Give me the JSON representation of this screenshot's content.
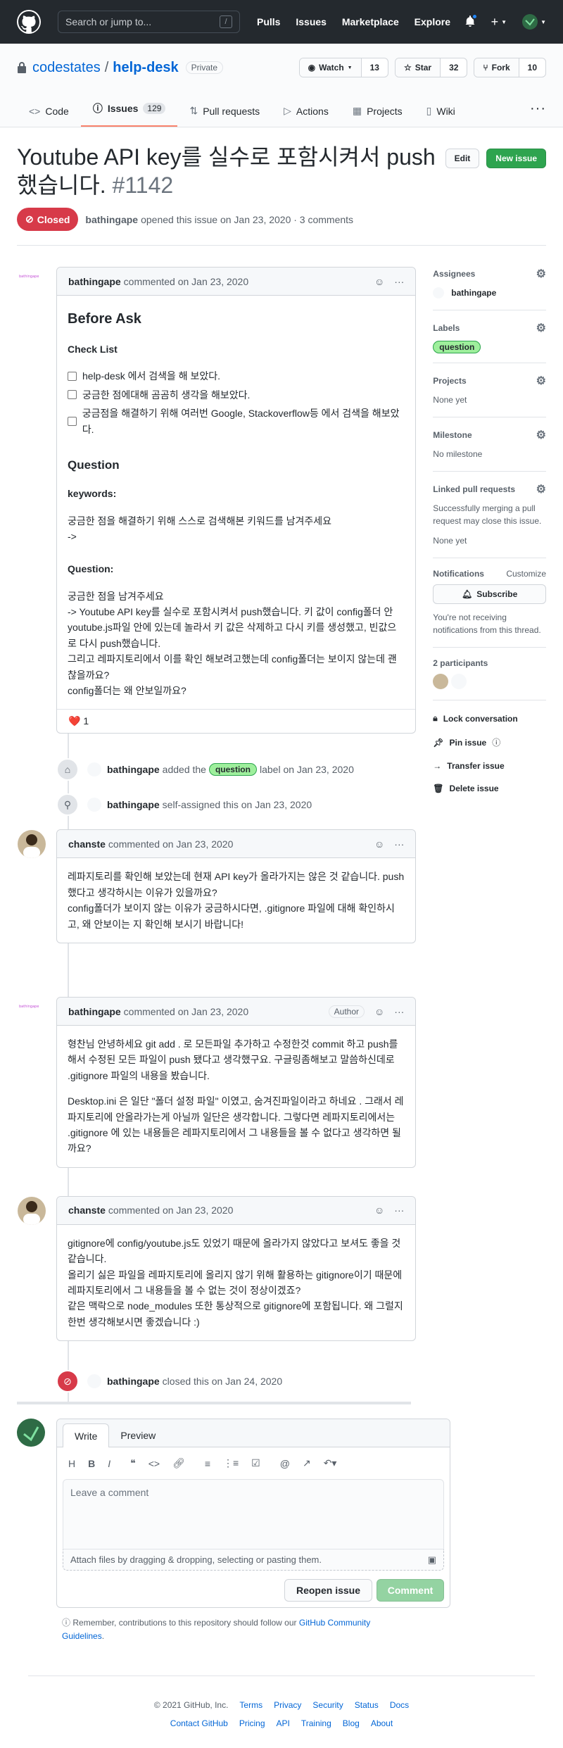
{
  "header": {
    "search_placeholder": "Search or jump to...",
    "slash": "/",
    "nav": [
      "Pulls",
      "Issues",
      "Marketplace",
      "Explore"
    ],
    "plus": "+"
  },
  "repo": {
    "owner": "codestates",
    "sep": "/",
    "name": "help-desk",
    "visibility": "Private",
    "watch_label": "Watch",
    "watch_count": "13",
    "star_label": "Star",
    "star_count": "32",
    "fork_label": "Fork",
    "fork_count": "10",
    "tabs": [
      {
        "label": "Code"
      },
      {
        "label": "Issues",
        "count": "129"
      },
      {
        "label": "Pull requests"
      },
      {
        "label": "Actions"
      },
      {
        "label": "Projects"
      },
      {
        "label": "Wiki"
      }
    ]
  },
  "issue": {
    "title": "Youtube API key를 실수로 포함시켜서 push했습니다.",
    "number": "#1142",
    "edit_label": "Edit",
    "new_issue_label": "New issue",
    "state": "Closed",
    "author": "bathingape",
    "opened_text": "opened this issue on Jan 23, 2020 · 3 comments"
  },
  "comments": [
    {
      "author": "bathingape",
      "date": "commented on Jan 23, 2020",
      "h_before": "Before Ask",
      "h_checklist": "Check List",
      "checklist": [
        "help-desk 에서 검색을 해 보았다.",
        "궁금한 점에대해 곰곰히 생각을 해보았다.",
        "궁금점을 해결하기 위해 여러번 Google, Stackoverflow등 에서 검색을 해보았다."
      ],
      "h_question": "Question",
      "h_keywords": "keywords:",
      "keywords_text": "궁금한 점을 해결하기 위해 스스로 검색해본 키워드를 남겨주세요",
      "keywords_arrow": "->",
      "h_question2": "Question:",
      "question_lines": [
        "궁금한 점을 남겨주세요",
        "-> Youtube API key를 실수로 포함시켜서 push했습니다. 키 값이 config폴더 안 youtube.js파일 안에 있는데 놀라서 키 값은 삭제하고 다시 키를 생성했고, 빈값으로 다시 push했습니다.",
        "그리고 레파지토리에서 이를 확인 해보려고했는데 config폴더는 보이지 않는데 괜찮을까요?",
        "config폴더는 왜 안보일까요?"
      ],
      "reaction_emoji": "❤️",
      "reaction_count": "1"
    },
    {
      "author": "chanste",
      "date": "commented on Jan 23, 2020",
      "lines": [
        "레파지토리를 확인해 보았는데 현재 API key가 올라가지는 않은 것 같습니다. push했다고 생각하시는 이유가 있을까요?",
        "config폴더가 보이지 않는 이유가 궁금하시다면, .gitignore 파일에 대해 확인하시고, 왜 안보이는 지 확인해 보시기 바랍니다!"
      ]
    },
    {
      "author": "bathingape",
      "date": "commented on Jan 23, 2020",
      "badge": "Author",
      "lines": [
        "형찬님 안녕하세요 git add . 로 모든파일 추가하고 수정한것 commit 하고 push를 해서 수정된 모든 파일이 push 됐다고 생각했구요. 구글링좀해보고 말씀하신데로 .gitignore 파일의 내용을 봤습니다.",
        "Desktop.ini 은 일단 \"폴더 설정 파일\" 이였고, 숨겨진파일이라고 하네요 . 그래서 레파지토리에 안올라가는게 아닐까 일단은 생각합니다. 그렇다면 레파지토리에서는 .gitignore 에 있는 내용들은 레파지토리에서 그 내용들을 볼 수 없다고 생각하면 될까요?"
      ]
    },
    {
      "author": "chanste",
      "date": "commented on Jan 23, 2020",
      "lines": [
        "gitignore에 config/youtube.js도 있었기 때문에 올라가지 않았다고 보셔도 좋을 것 같습니다.",
        "올리기 싫은 파일을 레파지토리에 올리지 않기 위해 활용하는 gitignore이기 때문에 레파지토리에서 그 내용들을 볼 수 없는 것이 정상이겠죠?",
        "같은 맥락으로 node_modules 또한 통상적으로 gitignore에 포함됩니다. 왜 그럴지 한번 생각해보시면 좋겠습니다 :)"
      ]
    }
  ],
  "events": {
    "label_actor": "bathingape",
    "label_pre": "added the",
    "label_name": "question",
    "label_post": "label on Jan 23, 2020",
    "assign_actor": "bathingape",
    "assign_text": "self-assigned this on Jan 23, 2020",
    "close_actor": "bathingape",
    "close_text": "closed this on Jan 24, 2020"
  },
  "sidebar": {
    "assignees_title": "Assignees",
    "assignee": "bathingape",
    "labels_title": "Labels",
    "label": "question",
    "projects_title": "Projects",
    "projects_value": "None yet",
    "milestone_title": "Milestone",
    "milestone_value": "No milestone",
    "linked_title": "Linked pull requests",
    "linked_desc": "Successfully merging a pull request may close this issue.",
    "linked_value": "None yet",
    "notif_title": "Notifications",
    "notif_customize": "Customize",
    "subscribe_label": "Subscribe",
    "notif_desc": "You're not receiving notifications from this thread.",
    "participants_title": "2 participants",
    "lock": "Lock conversation",
    "pin": "Pin issue",
    "transfer": "Transfer issue",
    "delete": "Delete issue"
  },
  "new_comment": {
    "tab_write": "Write",
    "tab_preview": "Preview",
    "placeholder": "Leave a comment",
    "attach": "Attach files by dragging & dropping, selecting or pasting them.",
    "reopen": "Reopen issue",
    "comment": "Comment",
    "remind_pre": "Remember, contributions to this repository should follow our",
    "remind_link": "GitHub Community Guidelines",
    "remind_post": "."
  },
  "footer": {
    "copyright": "© 2021 GitHub, Inc.",
    "row1": [
      "Terms",
      "Privacy",
      "Security",
      "Status",
      "Docs"
    ],
    "row2": [
      "Contact GitHub",
      "Pricing",
      "API",
      "Training",
      "Blog",
      "About"
    ]
  },
  "colors": {
    "header_bg": "#24292e",
    "closed": "#d73a49",
    "green": "#2ea44f",
    "link": "#0366d6",
    "label_bg": "#9eef9c"
  }
}
